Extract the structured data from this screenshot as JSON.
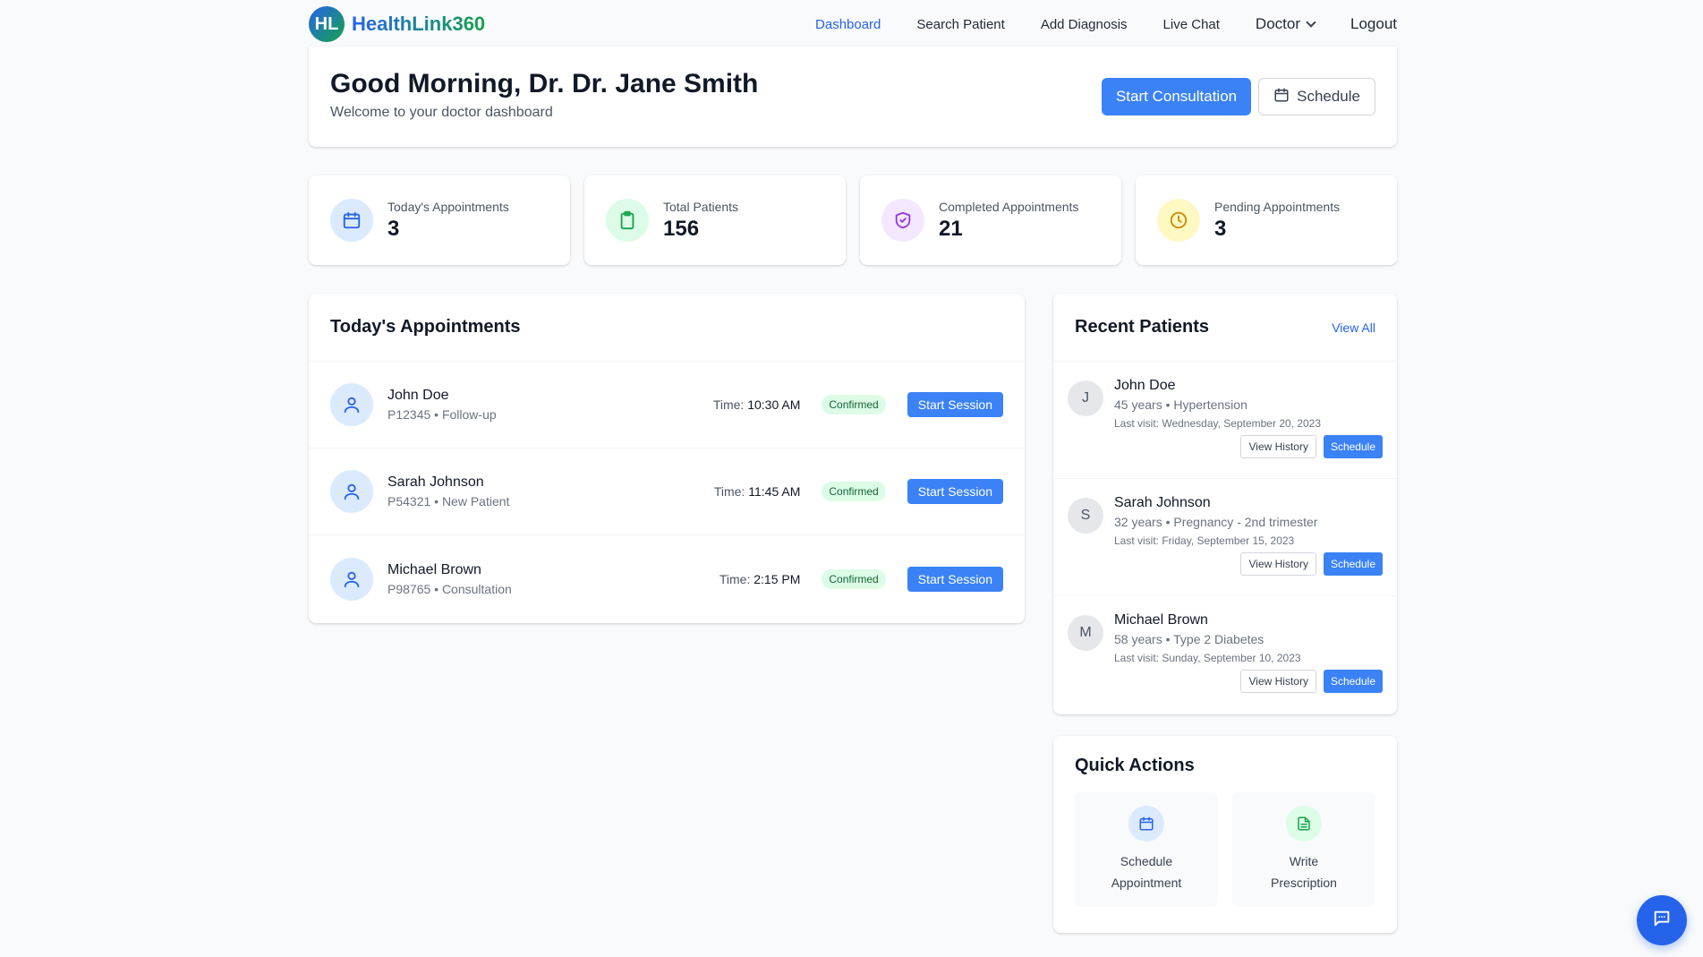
{
  "brand": {
    "logo_initials": "HL",
    "name": "HealthLink360"
  },
  "nav": {
    "items": [
      "Dashboard",
      "Search Patient",
      "Add Diagnosis",
      "Live Chat"
    ],
    "role": "Doctor",
    "logout": "Logout"
  },
  "welcome": {
    "greeting": "Good Morning, Dr. Dr. Jane Smith",
    "subtitle": "Welcome to your doctor dashboard",
    "start_consultation": "Start Consultation",
    "schedule": "Schedule"
  },
  "stats": [
    {
      "label": "Today's Appointments",
      "value": "3",
      "icon": "calendar-icon",
      "color": "#2563eb",
      "bg": "#dbeafe"
    },
    {
      "label": "Total Patients",
      "value": "156",
      "icon": "clipboard-icon",
      "color": "#16a34a",
      "bg": "#dcfce7"
    },
    {
      "label": "Completed Appointments",
      "value": "21",
      "icon": "shield-check-icon",
      "color": "#9333ea",
      "bg": "#f3e8ff"
    },
    {
      "label": "Pending Appointments",
      "value": "3",
      "icon": "clock-icon",
      "color": "#ca8a04",
      "bg": "#fef9c3"
    }
  ],
  "appointments": {
    "title": "Today's Appointments",
    "time_prefix": "Time:",
    "items": [
      {
        "name": "John Doe",
        "sub": "P12345 • Follow-up",
        "time": "10:30 AM",
        "status": "Confirmed",
        "action": "Start Session"
      },
      {
        "name": "Sarah Johnson",
        "sub": "P54321 • New Patient",
        "time": "11:45 AM",
        "status": "Confirmed",
        "action": "Start Session"
      },
      {
        "name": "Michael Brown",
        "sub": "P98765 • Consultation",
        "time": "2:15 PM",
        "status": "Confirmed",
        "action": "Start Session"
      }
    ]
  },
  "recent_patients": {
    "title": "Recent Patients",
    "view_all": "View All",
    "view_history": "View History",
    "schedule": "Schedule",
    "items": [
      {
        "initial": "J",
        "name": "John Doe",
        "detail": "45 years • Hypertension",
        "last_visit": "Last visit: Wednesday, September 20, 2023"
      },
      {
        "initial": "S",
        "name": "Sarah Johnson",
        "detail": "32 years • Pregnancy - 2nd trimester",
        "last_visit": "Last visit: Friday, September 15, 2023"
      },
      {
        "initial": "M",
        "name": "Michael Brown",
        "detail": "58 years • Type 2 Diabetes",
        "last_visit": "Last visit: Sunday, September 10, 2023"
      }
    ]
  },
  "quick_actions": {
    "title": "Quick Actions",
    "items": [
      {
        "label": "Schedule Appointment",
        "icon": "calendar-icon",
        "color": "#2563eb",
        "bg": "#dbeafe"
      },
      {
        "label": "Write Prescription",
        "icon": "document-icon",
        "color": "#16a34a",
        "bg": "#dcfce7"
      }
    ]
  },
  "colors": {
    "primary": "#3b82f6",
    "accent_blue": "#2563eb",
    "accent_green": "#16a34a"
  }
}
